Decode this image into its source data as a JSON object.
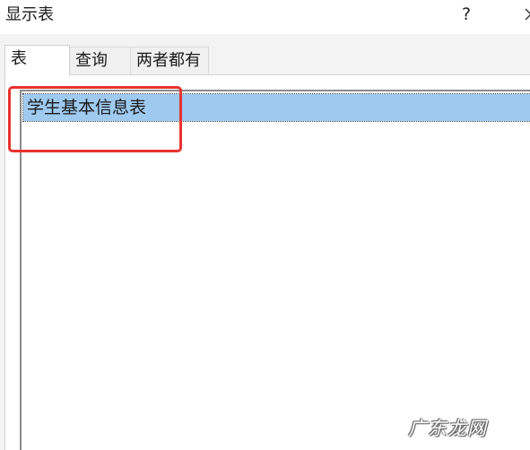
{
  "dialog": {
    "title": "显示表",
    "help_label": "?",
    "close_icon": "close-icon"
  },
  "tabs": [
    {
      "label": "表",
      "active": true
    },
    {
      "label": "查询",
      "active": false
    },
    {
      "label": "两者都有",
      "active": false
    }
  ],
  "table_list": {
    "items": [
      {
        "label": "学生基本信息表",
        "selected": true
      }
    ]
  },
  "annotation": {
    "highlight_color": "#e8332f"
  },
  "watermark": {
    "text": "广东龙网"
  },
  "colors": {
    "selection": "#9fcaf0",
    "dialog_bg": "#f3f3f3"
  }
}
